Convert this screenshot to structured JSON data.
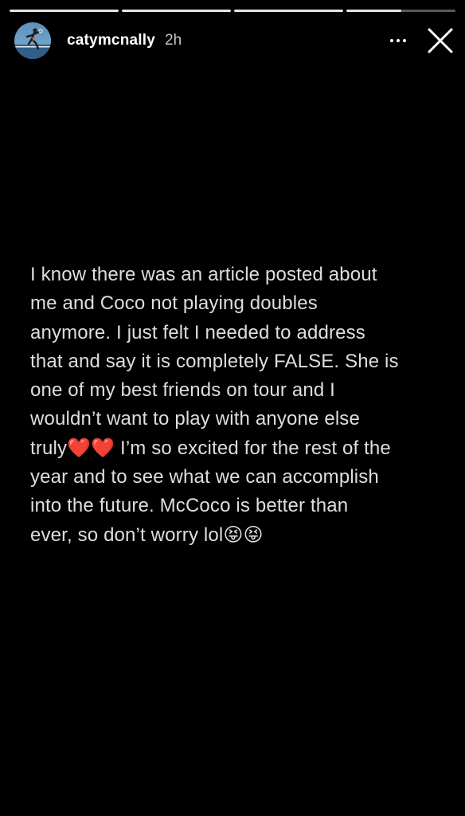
{
  "story": {
    "progress": [
      1,
      1,
      1,
      0.5
    ],
    "user": {
      "username": "catymcnally",
      "time": "2h"
    },
    "icons": {
      "more": "more-horizontal-icon",
      "close": "close-icon"
    },
    "text": {
      "line1": "I know there was an article posted about",
      "line2": "me and Coco not playing doubles",
      "line3": "anymore. I just felt I needed to address",
      "line4": "that and say it is completely FALSE. She is",
      "line5": "one of my best friends on tour and I",
      "line6": "wouldn’t want to play with anyone else",
      "line7_start": "truly",
      "line7_end": " I’m so excited for the rest of the",
      "line8": "year and to see what we can accomplish",
      "line9": "into the future. McCoco is better than",
      "line10": "ever, so don’t worry lol",
      "heart_emoji": "❤️",
      "tongue_emoji": "😝"
    },
    "colors": {
      "background": "#000000",
      "text": "#dedede",
      "heart": "#e0252a"
    }
  }
}
